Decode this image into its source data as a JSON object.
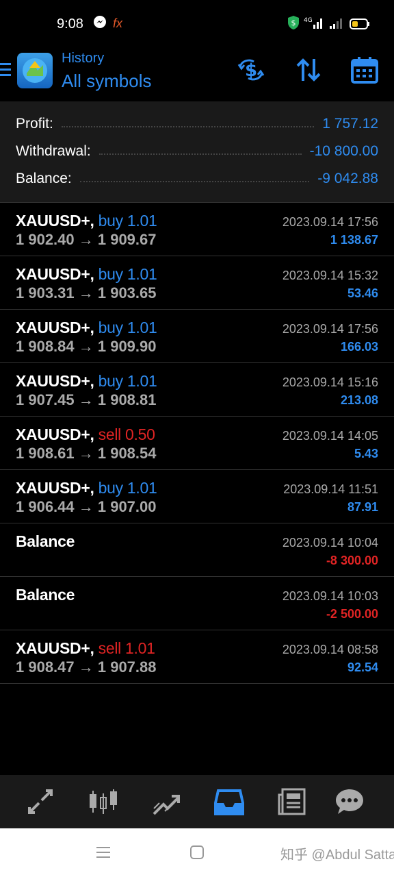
{
  "status_bar": {
    "time": "9:08"
  },
  "header": {
    "subtitle": "History",
    "title": "All symbols"
  },
  "summary": [
    {
      "label": "Profit:",
      "value": "1 757.12"
    },
    {
      "label": "Withdrawal:",
      "value": "-10 800.00"
    },
    {
      "label": "Balance:",
      "value": "-9 042.88"
    }
  ],
  "deals": [
    {
      "symbol": "XAUUSD+,",
      "side": "buy 1.01",
      "prices": "1 902.40 → 1 909.67",
      "time": "2023.09.14 17:56",
      "profit": "1 138.67"
    },
    {
      "symbol": "XAUUSD+,",
      "side": "buy 1.01",
      "prices": "1 903.31 → 1 903.65",
      "time": "2023.09.14 15:32",
      "profit": "53.46"
    },
    {
      "symbol": "XAUUSD+,",
      "side": "buy 1.01",
      "prices": "1 908.84 → 1 909.90",
      "time": "2023.09.14 17:56",
      "profit": "166.03"
    },
    {
      "symbol": "XAUUSD+,",
      "side": "buy 1.01",
      "prices": "1 907.45 → 1 908.81",
      "time": "2023.09.14 15:16",
      "profit": "213.08"
    },
    {
      "symbol": "XAUUSD+,",
      "side": "sell 0.50",
      "prices": "1 908.61 → 1 908.54",
      "time": "2023.09.14 14:05",
      "profit": "5.43"
    },
    {
      "symbol": "XAUUSD+,",
      "side": "buy 1.01",
      "prices": "1 906.44 → 1 907.00",
      "time": "2023.09.14 11:51",
      "profit": "87.91"
    },
    {
      "symbol": "Balance",
      "side": "",
      "prices": "",
      "time": "2023.09.14 10:04",
      "profit": "-8 300.00"
    },
    {
      "symbol": "Balance",
      "side": "",
      "prices": "",
      "time": "2023.09.14 10:03",
      "profit": "-2 500.00"
    },
    {
      "symbol": "XAUUSD+,",
      "side": "sell 1.01",
      "prices": "1 908.47 → 1 907.88",
      "time": "2023.09.14 08:58",
      "profit": "92.54"
    }
  ],
  "bottom_nav": [
    "quotes-icon",
    "chart-icon",
    "trade-icon",
    "history-icon",
    "news-icon",
    "messages-icon"
  ],
  "watermark": "知乎 @Abdul Sattar",
  "colors": {
    "accent": "#2f8cf0",
    "negative": "#e02424",
    "panel": "#1a1a1a"
  }
}
